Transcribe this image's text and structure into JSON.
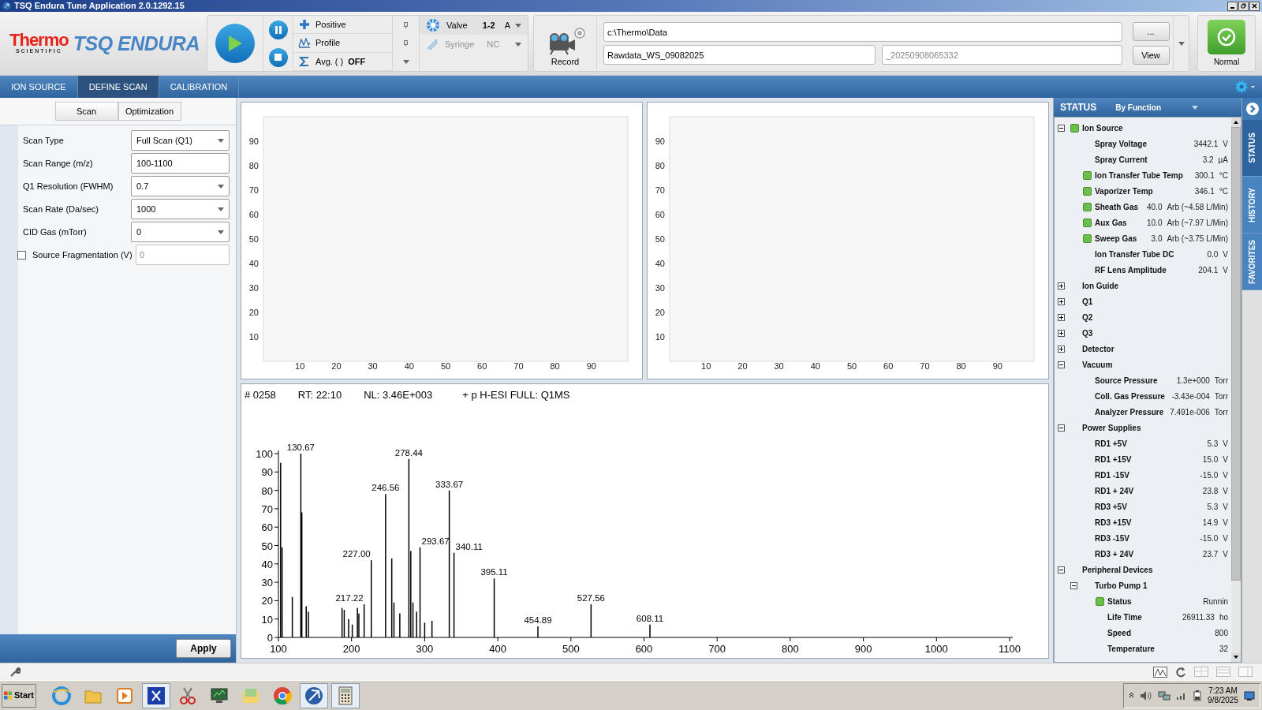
{
  "window": {
    "title": "TSQ Endura Tune Application 2.0.1292.15"
  },
  "toolbar": {
    "logo_brand": "Thermo",
    "logo_sub": "SCIENTIFIC",
    "logo_product": "TSQ ENDURA",
    "modes": [
      {
        "label": "Positive"
      },
      {
        "label": "Profile"
      },
      {
        "label": "Avg. ( )",
        "value": "OFF"
      }
    ],
    "valve": {
      "label": "Valve",
      "value": "1-2",
      "position": "A"
    },
    "syringe": {
      "label": "Syringe",
      "value": "NC",
      "disabled": true
    },
    "record": "Record",
    "path": "c:\\Thermo\\Data",
    "file_name": "Rawdata_WS_09082025",
    "suffix_placeholder": "_20250908065332",
    "browse": "...",
    "view": "View",
    "status": "Normal"
  },
  "tabs": [
    {
      "label": "ION SOURCE",
      "selected": false
    },
    {
      "label": "DEFINE SCAN",
      "selected": true
    },
    {
      "label": "CALIBRATION",
      "selected": false
    }
  ],
  "left_panel": {
    "subtabs": [
      {
        "label": "Scan",
        "selected": true
      },
      {
        "label": "Optimization",
        "selected": false
      }
    ],
    "fields": [
      {
        "label": "Scan Type",
        "value": "Full Scan (Q1)",
        "kind": "dropdown"
      },
      {
        "label": "Scan Range (m/z)",
        "value": "100-1100",
        "kind": "text"
      },
      {
        "label": "Q1 Resolution (FWHM)",
        "value": "0.7",
        "kind": "dropdown"
      },
      {
        "label": "Scan Rate (Da/sec)",
        "value": "1000",
        "kind": "dropdown"
      },
      {
        "label": "CID Gas (mTorr)",
        "value": "0",
        "kind": "dropdown"
      },
      {
        "label": "Source Fragmentation (V)",
        "value": "0",
        "kind": "checkbox",
        "checked": false
      }
    ],
    "apply": "Apply"
  },
  "plots": [
    {
      "chart_data": {
        "type": "line",
        "xlim": [
          0,
          100
        ],
        "ylim": [
          0,
          100
        ],
        "xticks": [
          10,
          20,
          30,
          40,
          50,
          60,
          70,
          80,
          90
        ],
        "yticks": [
          10,
          20,
          30,
          40,
          50,
          60,
          70,
          80,
          90
        ]
      }
    },
    {
      "chart_data": {
        "type": "line",
        "xlim": [
          0,
          100
        ],
        "ylim": [
          0,
          100
        ],
        "xticks": [
          10,
          20,
          30,
          40,
          50,
          60,
          70,
          80,
          90
        ],
        "yticks": [
          10,
          20,
          30,
          40,
          50,
          60,
          70,
          80,
          90
        ]
      }
    }
  ],
  "spectrum": {
    "scan": "# 0258",
    "rt": "RT: 22:10",
    "nl": "NL: 3.46E+003",
    "filter": "+ p H-ESI FULL: Q1MS",
    "chart_data": {
      "type": "bar",
      "xlim": [
        100,
        1100
      ],
      "ylim": [
        0,
        100
      ],
      "x": [
        103,
        105,
        119,
        130.67,
        132,
        138,
        141,
        187,
        190,
        196,
        201,
        208,
        210,
        217.22,
        227,
        246.56,
        255,
        258,
        266,
        278.44,
        281,
        284,
        289,
        293.67,
        300,
        310,
        333.67,
        340.11,
        395.11,
        454.89,
        527.56,
        608.11
      ],
      "series": [
        {
          "color": "#000000",
          "values": [
            95,
            49,
            22,
            100,
            68,
            17,
            14,
            16,
            15,
            10,
            7,
            16,
            13,
            18,
            42,
            78,
            43,
            19,
            13,
            97,
            47,
            19,
            14,
            49,
            8,
            9,
            80,
            46,
            32,
            6,
            18,
            7
          ]
        }
      ],
      "xticks": [
        100,
        200,
        300,
        400,
        500,
        600,
        700,
        800,
        900,
        1000,
        1100
      ],
      "yticks": [
        0,
        10,
        20,
        30,
        40,
        50,
        60,
        70,
        80,
        90,
        100
      ],
      "annotations": [
        {
          "x": 130.67,
          "y": 100,
          "text": "130.67"
        },
        {
          "x": 217.22,
          "y": 18,
          "text": "217.22"
        },
        {
          "x": 227,
          "y": 42,
          "text": "227.00"
        },
        {
          "x": 246.56,
          "y": 78,
          "text": "246.56"
        },
        {
          "x": 278.44,
          "y": 97,
          "text": "278.44"
        },
        {
          "x": 293.67,
          "y": 49,
          "text": "293.67"
        },
        {
          "x": 333.67,
          "y": 80,
          "text": "333.67"
        },
        {
          "x": 340.11,
          "y": 46,
          "text": "340.11"
        },
        {
          "x": 395.11,
          "y": 32,
          "text": "395.11"
        },
        {
          "x": 454.89,
          "y": 6,
          "text": "454.89"
        },
        {
          "x": 527.56,
          "y": 18,
          "text": "527.56"
        },
        {
          "x": 608.11,
          "y": 7,
          "text": "608.11"
        }
      ]
    }
  },
  "status_panel": {
    "title": "STATUS",
    "view": "By Function",
    "tree": [
      {
        "label": "Ion Source",
        "color": "#6cc04a",
        "expanded": true,
        "children": [
          {
            "label": "Spray Voltage",
            "value": "3442.1",
            "unit": "V"
          },
          {
            "label": "Spray Current",
            "value": "3.2",
            "unit": "µA"
          },
          {
            "label": "Ion Transfer Tube Temp",
            "value": "300.1",
            "unit": "°C",
            "color": "#6cc04a"
          },
          {
            "label": "Vaporizer Temp",
            "value": "346.1",
            "unit": "°C",
            "color": "#6cc04a"
          },
          {
            "label": "Sheath Gas",
            "value": "40.0",
            "unit": "Arb (~4.58 L/Min)",
            "color": "#6cc04a"
          },
          {
            "label": "Aux Gas",
            "value": "10.0",
            "unit": "Arb (~7.97 L/Min)",
            "color": "#6cc04a"
          },
          {
            "label": "Sweep Gas",
            "value": "3.0",
            "unit": "Arb (~3.75 L/Min)",
            "color": "#6cc04a"
          },
          {
            "label": "Ion Transfer Tube DC",
            "value": "0.0",
            "unit": "V"
          },
          {
            "label": "RF Lens Amplitude",
            "value": "204.1",
            "unit": "V"
          }
        ]
      },
      {
        "label": "Ion Guide",
        "expanded": false
      },
      {
        "label": "Q1",
        "expanded": false
      },
      {
        "label": "Q2",
        "expanded": false
      },
      {
        "label": "Q3",
        "expanded": false
      },
      {
        "label": "Detector",
        "expanded": false
      },
      {
        "label": "Vacuum",
        "expanded": true,
        "children": [
          {
            "label": "Source Pressure",
            "value": "1.3e+000",
            "unit": "Torr"
          },
          {
            "label": "Coll. Gas Pressure",
            "value": "-3.43e-004",
            "unit": "Torr"
          },
          {
            "label": "Analyzer Pressure",
            "value": "7.491e-006",
            "unit": "Torr"
          }
        ]
      },
      {
        "label": "Power Supplies",
        "expanded": true,
        "children": [
          {
            "label": "RD1 +5V",
            "value": "5.3",
            "unit": "V"
          },
          {
            "label": "RD1 +15V",
            "value": "15.0",
            "unit": "V"
          },
          {
            "label": "RD1 -15V",
            "value": "-15.0",
            "unit": "V"
          },
          {
            "label": "RD1 + 24V",
            "value": "23.8",
            "unit": "V"
          },
          {
            "label": "RD3 +5V",
            "value": "5.3",
            "unit": "V"
          },
          {
            "label": "RD3 +15V",
            "value": "14.9",
            "unit": "V"
          },
          {
            "label": "RD3 -15V",
            "value": "-15.0",
            "unit": "V"
          },
          {
            "label": "RD3 + 24V",
            "value": "23.7",
            "unit": "V"
          }
        ]
      },
      {
        "label": "Peripheral Devices",
        "expanded": true,
        "children": [
          {
            "label": "Turbo Pump 1",
            "expanded": true,
            "children": [
              {
                "label": "Status",
                "value": "Runnin",
                "color": "#6cc04a"
              },
              {
                "label": "Life Time",
                "value": "26911.33",
                "unit": "ho"
              },
              {
                "label": "Speed",
                "value": "800"
              },
              {
                "label": "Temperature",
                "value": "32"
              }
            ]
          }
        ]
      }
    ]
  },
  "side_tabs": [
    {
      "label": "STATUS",
      "selected": true
    },
    {
      "label": "HISTORY",
      "selected": false
    },
    {
      "label": "FAVORITES",
      "selected": false
    }
  ],
  "taskbar": {
    "start": "Start",
    "time": "7:23 AM",
    "date": "9/8/2025"
  }
}
